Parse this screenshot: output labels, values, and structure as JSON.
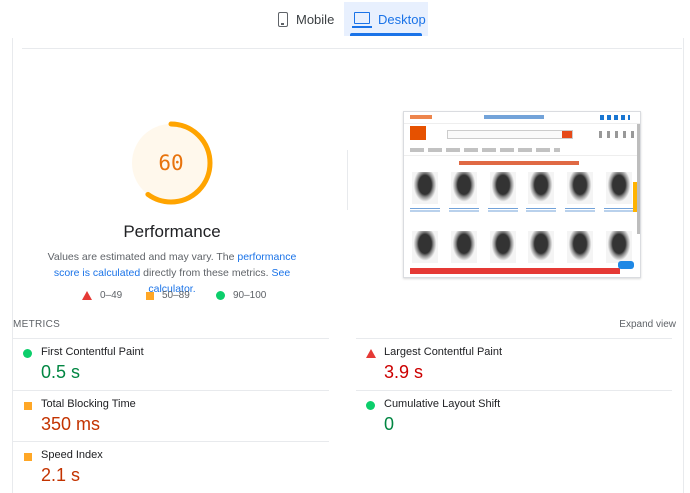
{
  "tabs": [
    {
      "label": "Mobile",
      "icon": "phone-icon",
      "active": false
    },
    {
      "label": "Desktop",
      "icon": "desktop-icon",
      "active": true
    }
  ],
  "performance": {
    "score": "60",
    "score_fraction": 0.6,
    "title": "Performance",
    "desc_prefix": "Values are estimated and may vary. The ",
    "desc_link1": "performance score is calculated",
    "desc_middle": " directly from these metrics. ",
    "desc_link2": "See calculator.",
    "colors": {
      "gauge_arc": "#ffa400",
      "gauge_bg": "#fff8ec",
      "score_text": "#e8730c"
    }
  },
  "legend": [
    {
      "label": "0–49",
      "shape": "triangle",
      "color": "#e53935"
    },
    {
      "label": "50–89",
      "shape": "square",
      "color": "#ffa726"
    },
    {
      "label": "90–100",
      "shape": "circle",
      "color": "#0cce6b"
    }
  ],
  "metrics_header": {
    "label": "METRICS",
    "expand": "Expand view"
  },
  "metrics": [
    {
      "name": "First Contentful Paint",
      "value": "0.5 s",
      "rating": "green"
    },
    {
      "name": "Largest Contentful Paint",
      "value": "3.9 s",
      "rating": "red"
    },
    {
      "name": "Total Blocking Time",
      "value": "350 ms",
      "rating": "orange"
    },
    {
      "name": "Cumulative Layout Shift",
      "value": "0",
      "rating": "green"
    },
    {
      "name": "Speed Index",
      "value": "2.1 s",
      "rating": "orange"
    }
  ]
}
